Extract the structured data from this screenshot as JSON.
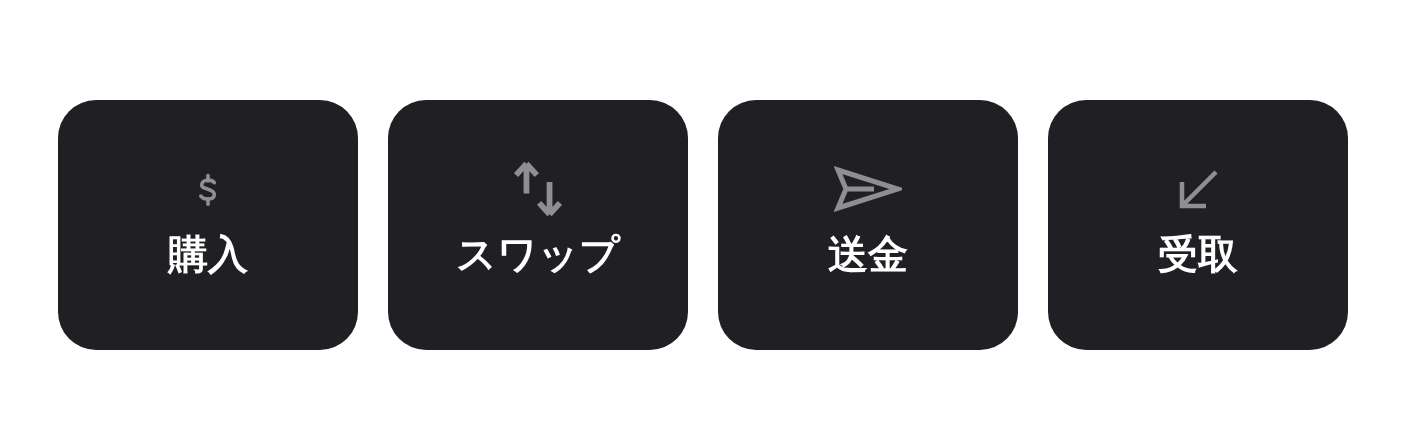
{
  "actions": [
    {
      "kind": "dollar",
      "label": "購入"
    },
    {
      "kind": "swap",
      "label": "スワップ"
    },
    {
      "kind": "send",
      "label": "送金"
    },
    {
      "kind": "receive",
      "label": "受取"
    }
  ]
}
